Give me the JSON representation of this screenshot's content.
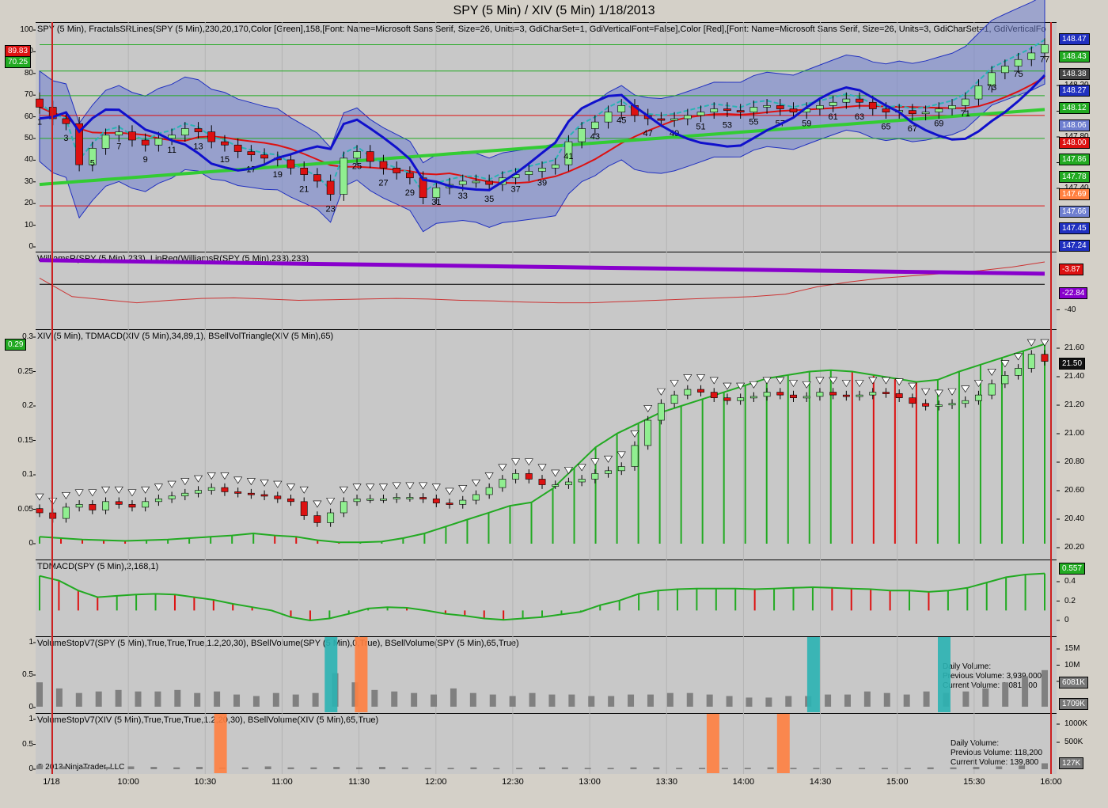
{
  "title": "SPY (5 Min) / XIV (5 Min)  1/18/2013",
  "copyright": "© 2013 NinjaTrader, LLC",
  "colors": {
    "up": "#22aa22",
    "down": "#dd1111",
    "band": "#6f7fd0",
    "blue": "#1010cc",
    "purple": "#8800cc",
    "cyan": "#2ab3b3",
    "orange": "#ff8040",
    "marker": "#cc2020"
  },
  "x_axis": {
    "labels": [
      "1/18",
      "10:00",
      "10:30",
      "11:00",
      "11:30",
      "12:00",
      "12:30",
      "13:00",
      "13:30",
      "14:00",
      "14:30",
      "15:00",
      "15:30",
      "16:00"
    ]
  },
  "panes": {
    "price": {
      "label": "SPY (5 Min), FractalsSRLines(SPY (5 Min),230,20,170,Color [Green],158,[Font: Name=Microsoft Sans Serif, Size=26, Units=3, GdiCharSet=1, GdiVerticalFont=False],Color [Red],[Font: Name=Microsoft Sans Serif, Size=26, Units=3, GdiCharSet=1, GdiVerticalFo",
      "left_ticks": [
        "100",
        "90",
        "80",
        "70",
        "60",
        "50",
        "40",
        "30",
        "20",
        "10",
        "0"
      ],
      "left_tags": [
        {
          "text": "89.83",
          "color": "#dd1111"
        },
        {
          "text": "70.25",
          "color": "#22aa22"
        }
      ],
      "right_ticks": [
        "148.20",
        "148.00",
        "147.80",
        "147.60",
        "147.40"
      ],
      "right_tags": [
        {
          "text": "148.47",
          "color": "#2030c0"
        },
        {
          "text": "148.43",
          "color": "#22aa22"
        },
        {
          "text": "148.38",
          "color": "#444444"
        },
        {
          "text": "148.27",
          "color": "#2030c0"
        },
        {
          "text": "148.12",
          "color": "#22aa22"
        },
        {
          "text": "148.06",
          "color": "#6f7fd0"
        },
        {
          "text": "148.00",
          "color": "#dd1111"
        },
        {
          "text": "147.86",
          "color": "#22aa22"
        },
        {
          "text": "147.78",
          "color": "#22aa22"
        },
        {
          "text": "147.69",
          "color": "#ff8040"
        },
        {
          "text": "147.66",
          "color": "#6f7fd0"
        },
        {
          "text": "147.45",
          "color": "#2030c0"
        },
        {
          "text": "147.24",
          "color": "#2030c0"
        }
      ],
      "bar_labels": [
        "1",
        "3",
        "5",
        "7",
        "9",
        "11",
        "13",
        "15",
        "17",
        "19",
        "21",
        "23",
        "25",
        "27",
        "29",
        "31",
        "33",
        "35",
        "37",
        "39",
        "41",
        "43",
        "45",
        "47",
        "49",
        "51",
        "53",
        "55",
        "57",
        "59",
        "61",
        "63",
        "65",
        "67",
        "69",
        "71",
        "73",
        "75",
        "77"
      ]
    },
    "williams": {
      "label": "WilliamsR(SPY (5 Min),233), LinReg(WilliamsR(SPY (5 Min),233),233)",
      "right_ticks": [
        "-40"
      ],
      "right_tags": [
        {
          "text": "-3.87",
          "color": "#dd1111"
        },
        {
          "text": "-22.84",
          "color": "#8800cc"
        }
      ]
    },
    "xiv": {
      "label": "XIV (5 Min), TDMACD(XIV (5 Min),34,89,1), BSellVolTriangle(XIV (5 Min),65)",
      "left_ticks": [
        "0.3",
        "0.25",
        "0.2",
        "0.15",
        "0.1",
        "0.05",
        "0"
      ],
      "left_tags": [
        {
          "text": "0.29",
          "color": "#22aa22"
        }
      ],
      "right_ticks": [
        "21.60",
        "21.40",
        "21.20",
        "21.00",
        "20.80",
        "20.60",
        "20.40",
        "20.20"
      ],
      "right_tags": [
        {
          "text": "21.50",
          "color": "#111111"
        }
      ]
    },
    "tdmacd": {
      "label": "TDMACD(SPY (5 Min),2,168,1)",
      "right_ticks": [
        "0.4",
        "0.2",
        "0"
      ],
      "right_tags": [
        {
          "text": "0.557",
          "color": "#22aa22"
        }
      ]
    },
    "vol_spy": {
      "label": "VolumeStopV7(SPY (5 Min),True,True,True,1.2,20,30), BSellVolume(SPY (5 Min),0,True), BSellVolume(SPY (5 Min),65,True)",
      "left_ticks": [
        "1",
        "0.5",
        "0"
      ],
      "right_ticks": [
        "15M",
        "10M",
        "5M"
      ],
      "right_tags": [
        {
          "text": "6081K",
          "color": "#777777"
        },
        {
          "text": "1709K",
          "color": "#777777"
        }
      ],
      "info": {
        "title": "Daily Volume:",
        "previous": "Previous Volume: 3,939,000",
        "current": "Current Volume: 6,081,600"
      }
    },
    "vol_xiv": {
      "label": "VolumeStopV7(XIV (5 Min),True,True,True,1.2,20,30), BSellVolume(XIV (5 Min),65,True)",
      "left_ticks": [
        "1",
        "0.5",
        "0"
      ],
      "right_ticks": [
        "1000K",
        "500K"
      ],
      "right_tags": [
        {
          "text": "127K",
          "color": "#777777"
        }
      ],
      "info": {
        "title": "Daily Volume:",
        "previous": "Previous Volume: 118,200",
        "current": "Current Volume: 139,800"
      }
    }
  },
  "chart_data": [
    {
      "type": "candlestick",
      "title": "SPY (5 Min)",
      "ylim": [
        147.2,
        148.5
      ],
      "close": [
        148.05,
        147.98,
        147.95,
        147.7,
        147.8,
        147.88,
        147.9,
        147.85,
        147.82,
        147.86,
        147.88,
        147.92,
        147.9,
        147.84,
        147.82,
        147.78,
        147.76,
        147.74,
        147.73,
        147.68,
        147.64,
        147.6,
        147.52,
        147.74,
        147.78,
        147.72,
        147.68,
        147.65,
        147.62,
        147.5,
        147.56,
        147.58,
        147.6,
        147.6,
        147.58,
        147.62,
        147.64,
        147.66,
        147.68,
        147.7,
        147.84,
        147.92,
        147.96,
        148.02,
        148.06,
        148.0,
        147.98,
        147.97,
        147.98,
        148.0,
        148.02,
        148.04,
        148.03,
        148.02,
        148.05,
        148.06,
        148.04,
        148.02,
        148.04,
        148.06,
        148.08,
        148.1,
        148.08,
        148.04,
        148.02,
        148.03,
        148.01,
        148.02,
        148.04,
        148.06,
        148.1,
        148.18,
        148.26,
        148.3,
        148.34,
        148.38,
        148.43
      ],
      "williams_r": [
        -30,
        -60,
        -65,
        -70,
        -66,
        -63,
        -62,
        -64,
        -66,
        -65,
        -64,
        -63,
        -64,
        -66,
        -67,
        -69,
        -70,
        -70,
        -68,
        -66,
        -64,
        -62,
        -60,
        -56,
        -44,
        -36,
        -30,
        -26,
        -22,
        -18,
        -12,
        -3.87
      ],
      "williams_linreg": [
        -1,
        -22.84
      ]
    },
    {
      "type": "candlestick",
      "title": "XIV (5 Min)",
      "ylim": [
        20.2,
        21.65
      ],
      "close": [
        20.42,
        20.38,
        20.46,
        20.48,
        20.44,
        20.5,
        20.48,
        20.46,
        20.5,
        20.52,
        20.54,
        20.56,
        20.58,
        20.6,
        20.57,
        20.56,
        20.55,
        20.54,
        20.52,
        20.5,
        20.4,
        20.35,
        20.42,
        20.5,
        20.52,
        20.52,
        20.52,
        20.53,
        20.53,
        20.52,
        20.49,
        20.48,
        20.51,
        20.55,
        20.6,
        20.66,
        20.7,
        20.66,
        20.62,
        20.62,
        20.64,
        20.66,
        20.7,
        20.72,
        20.75,
        20.9,
        21.08,
        21.2,
        21.26,
        21.3,
        21.28,
        21.24,
        21.22,
        21.24,
        21.25,
        21.28,
        21.26,
        21.24,
        21.25,
        21.28,
        21.26,
        21.25,
        21.26,
        21.28,
        21.27,
        21.24,
        21.2,
        21.18,
        21.19,
        21.2,
        21.22,
        21.26,
        21.34,
        21.4,
        21.45,
        21.55,
        21.5
      ],
      "tdmacd_xiv": [
        0.01,
        0.008,
        0.006,
        0.005,
        0.004,
        0.005,
        0.006,
        0.008,
        0.01,
        0.012,
        0.015,
        0.012,
        0.01,
        0.005,
        0.002,
        0.002,
        0.003,
        0.008,
        0.015,
        0.025,
        0.035,
        0.045,
        0.055,
        0.06,
        0.08,
        0.11,
        0.14,
        0.16,
        0.175,
        0.19,
        0.2,
        0.21,
        0.22,
        0.23,
        0.24,
        0.245,
        0.25,
        0.252,
        0.25,
        0.245,
        0.24,
        0.235,
        0.238,
        0.25,
        0.26,
        0.27,
        0.28,
        0.29
      ]
    },
    {
      "type": "bar",
      "title": "TDMACD(SPY (5 Min),2,168,1)",
      "values": [
        0.52,
        0.45,
        0.3,
        0.2,
        0.22,
        0.24,
        0.25,
        0.24,
        0.2,
        0.16,
        0.1,
        0.05,
        0.0,
        -0.1,
        -0.15,
        -0.12,
        -0.05,
        0.03,
        0.05,
        0.04,
        0.0,
        -0.05,
        -0.08,
        -0.12,
        -0.14,
        -0.12,
        -0.1,
        -0.06,
        -0.02,
        0.08,
        0.15,
        0.25,
        0.3,
        0.32,
        0.33,
        0.33,
        0.33,
        0.32,
        0.33,
        0.34,
        0.35,
        0.34,
        0.33,
        0.32,
        0.3,
        0.3,
        0.28,
        0.3,
        0.34,
        0.42,
        0.5,
        0.54,
        0.557
      ]
    },
    {
      "type": "bar",
      "title": "VolumeStopV7(SPY (5 Min))",
      "values": [
        1.6,
        1.2,
        0.9,
        1.0,
        1.1,
        1.0,
        1.0,
        1.1,
        0.9,
        1.0,
        0.8,
        0.7,
        0.9,
        0.8,
        0.9,
        2.2,
        1.6,
        1.1,
        1.0,
        0.9,
        0.8,
        1.2,
        0.9,
        0.8,
        0.7,
        0.9,
        0.8,
        0.8,
        0.7,
        0.7,
        0.8,
        0.8,
        0.9,
        0.9,
        0.8,
        0.7,
        0.6,
        0.6,
        0.7,
        0.7,
        0.8,
        0.8,
        1.0,
        0.9,
        0.8,
        1.0,
        0.9,
        1.0,
        1.2,
        1.6,
        2.0,
        2.4
      ]
    },
    {
      "type": "bar",
      "title": "VolumeStopV7(XIV (5 Min))",
      "values": [
        80,
        60,
        50,
        50,
        60,
        50,
        40,
        50,
        40,
        40,
        60,
        40,
        40,
        50,
        40,
        50,
        40,
        30,
        30,
        40,
        30,
        30,
        40,
        40,
        30,
        30,
        40,
        40,
        30,
        30,
        30,
        30,
        40,
        30,
        30,
        30,
        30,
        30,
        30,
        40,
        40,
        50,
        60,
        80,
        127
      ]
    }
  ]
}
